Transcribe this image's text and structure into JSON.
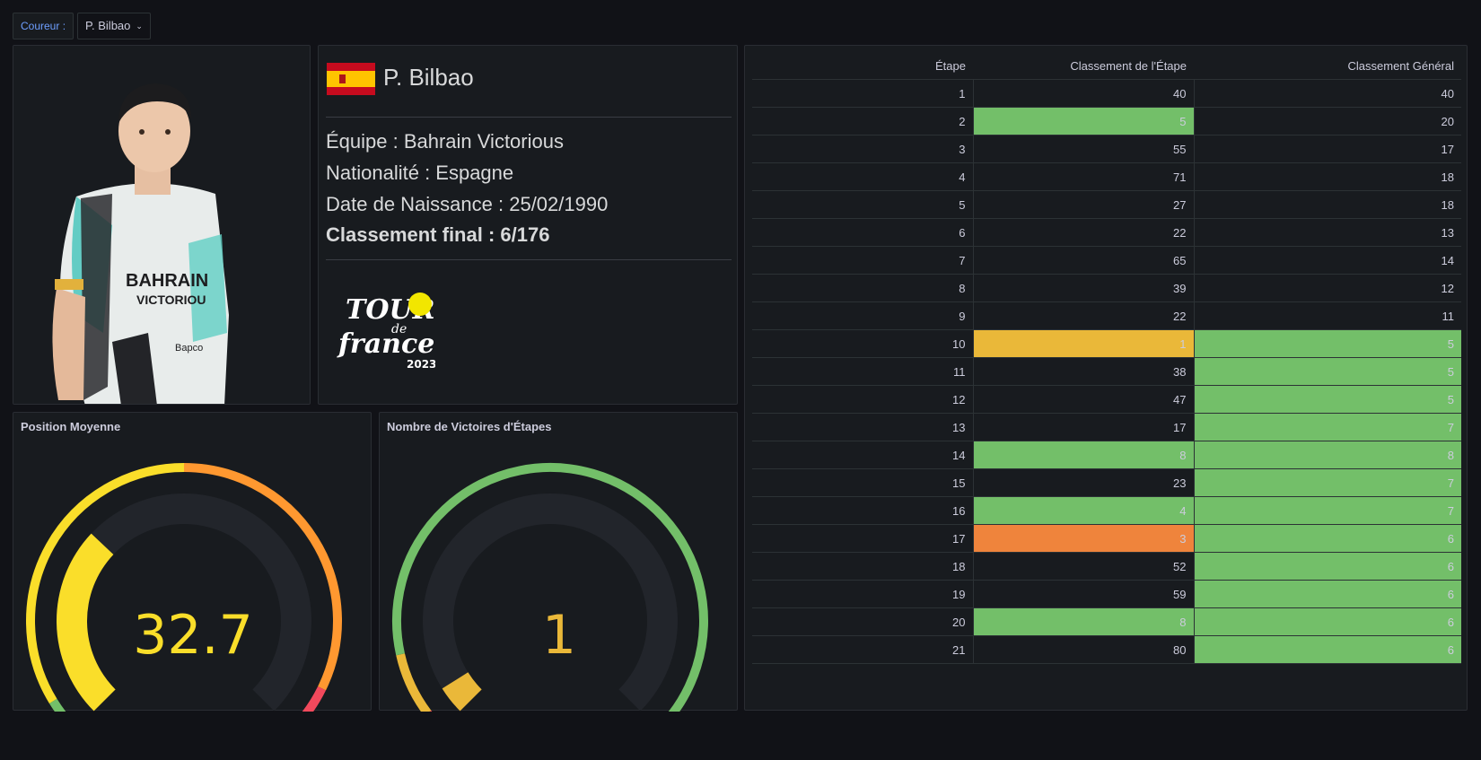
{
  "variable": {
    "label": "Coureur :",
    "value": "P. Bilbao",
    "chevron_icon": "chevron-down-icon"
  },
  "rider": {
    "name": "P. Bilbao",
    "team_line": "Équipe : Bahrain Victorious",
    "nationality_line": "Nationalité : Espagne",
    "birth_line": "Date de Naissance : 25/02/1990",
    "final_line": "Classement final : 6/176",
    "flag": "spain-flag-icon",
    "logo": {
      "line1": "TOUR",
      "line2": "de",
      "line3": "france",
      "year": "2023"
    }
  },
  "gauges": [
    {
      "title": "Position Moyenne",
      "value": "32.7",
      "value_color": "#fade2a",
      "level": 0.327
    },
    {
      "title": "Nombre de Victoires d'Étapes",
      "value": "1",
      "value_color": "#eab839",
      "level": 0.048
    }
  ],
  "colors": {
    "green": "#73bf69",
    "yellow": "#eab839",
    "orange": "#ef843c",
    "red": "#f2495c",
    "bright_yellow": "#fade2a"
  },
  "table": {
    "headers": [
      "Étape",
      "Classement de l'Étape",
      "Classement Général"
    ],
    "rows": [
      {
        "stage": "1",
        "rank": "40",
        "gen": "40",
        "rank_bg": "",
        "gen_bg": ""
      },
      {
        "stage": "2",
        "rank": "5",
        "gen": "20",
        "rank_bg": "#73bf69",
        "gen_bg": ""
      },
      {
        "stage": "3",
        "rank": "55",
        "gen": "17",
        "rank_bg": "",
        "gen_bg": ""
      },
      {
        "stage": "4",
        "rank": "71",
        "gen": "18",
        "rank_bg": "",
        "gen_bg": ""
      },
      {
        "stage": "5",
        "rank": "27",
        "gen": "18",
        "rank_bg": "",
        "gen_bg": ""
      },
      {
        "stage": "6",
        "rank": "22",
        "gen": "13",
        "rank_bg": "",
        "gen_bg": ""
      },
      {
        "stage": "7",
        "rank": "65",
        "gen": "14",
        "rank_bg": "",
        "gen_bg": ""
      },
      {
        "stage": "8",
        "rank": "39",
        "gen": "12",
        "rank_bg": "",
        "gen_bg": ""
      },
      {
        "stage": "9",
        "rank": "22",
        "gen": "11",
        "rank_bg": "",
        "gen_bg": ""
      },
      {
        "stage": "10",
        "rank": "1",
        "gen": "5",
        "rank_bg": "#eab839",
        "gen_bg": "#73bf69"
      },
      {
        "stage": "11",
        "rank": "38",
        "gen": "5",
        "rank_bg": "",
        "gen_bg": "#73bf69"
      },
      {
        "stage": "12",
        "rank": "47",
        "gen": "5",
        "rank_bg": "",
        "gen_bg": "#73bf69"
      },
      {
        "stage": "13",
        "rank": "17",
        "gen": "7",
        "rank_bg": "",
        "gen_bg": "#73bf69"
      },
      {
        "stage": "14",
        "rank": "8",
        "gen": "8",
        "rank_bg": "#73bf69",
        "gen_bg": "#73bf69"
      },
      {
        "stage": "15",
        "rank": "23",
        "gen": "7",
        "rank_bg": "",
        "gen_bg": "#73bf69"
      },
      {
        "stage": "16",
        "rank": "4",
        "gen": "7",
        "rank_bg": "#73bf69",
        "gen_bg": "#73bf69"
      },
      {
        "stage": "17",
        "rank": "3",
        "gen": "6",
        "rank_bg": "#ef843c",
        "gen_bg": "#73bf69"
      },
      {
        "stage": "18",
        "rank": "52",
        "gen": "6",
        "rank_bg": "",
        "gen_bg": "#73bf69"
      },
      {
        "stage": "19",
        "rank": "59",
        "gen": "6",
        "rank_bg": "",
        "gen_bg": "#73bf69"
      },
      {
        "stage": "20",
        "rank": "8",
        "gen": "6",
        "rank_bg": "#73bf69",
        "gen_bg": "#73bf69"
      },
      {
        "stage": "21",
        "rank": "80",
        "gen": "6",
        "rank_bg": "",
        "gen_bg": "#73bf69"
      }
    ]
  }
}
